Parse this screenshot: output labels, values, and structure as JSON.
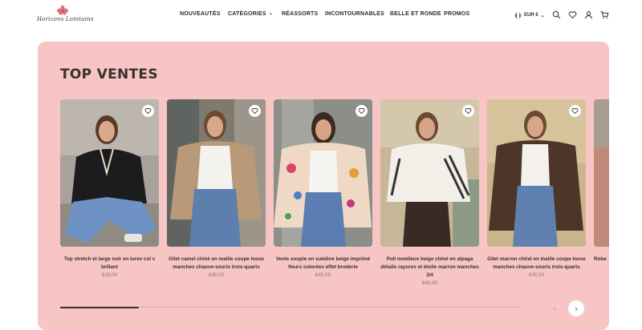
{
  "header": {
    "logo_text": "Horizons Lointains",
    "nav": [
      {
        "label": "NOUVEAUTÉS",
        "dropdown": false
      },
      {
        "label": "CATÉGORIES",
        "dropdown": true
      },
      {
        "label": "RÉASSORTS",
        "dropdown": false
      },
      {
        "label": "INCONTOURNABLES",
        "dropdown": false
      },
      {
        "label": "BELLE ET RONDE",
        "dropdown": false
      },
      {
        "label": "PROMOS",
        "dropdown": false
      }
    ],
    "currency": "EUR €",
    "icons": [
      "search-icon",
      "heart-icon",
      "user-icon",
      "cart-icon"
    ]
  },
  "section": {
    "title": "TOP VENTES"
  },
  "products": [
    {
      "name": "Top stretch et large noir en lurex col v brillant",
      "price": "€29,00"
    },
    {
      "name": "Gilet camel chiné en maille coupe loose manches chauve-souris trois-quarts",
      "price": "€35,00"
    },
    {
      "name": "Veste souple en suédine beige imprimé fleurs colorées effet broderie",
      "price": "€45,00"
    },
    {
      "name": "Pull moelleux beige chiné en alpaga détails rayures et étoile marron manches 3/4",
      "price": "€45,00"
    },
    {
      "name": "Gilet marron chiné en maille coupe loose manches chauve-souris trois-quarts",
      "price": "€35,00"
    },
    {
      "name": "Robe",
      "price": ""
    }
  ],
  "carousel": {
    "progress": 0.17,
    "prev_icon": "chevron-left-icon",
    "next_icon": "chevron-right-icon"
  },
  "colors": {
    "panel": "#f7c5c4",
    "text": "#3a3030",
    "price": "#8a6f6f"
  }
}
